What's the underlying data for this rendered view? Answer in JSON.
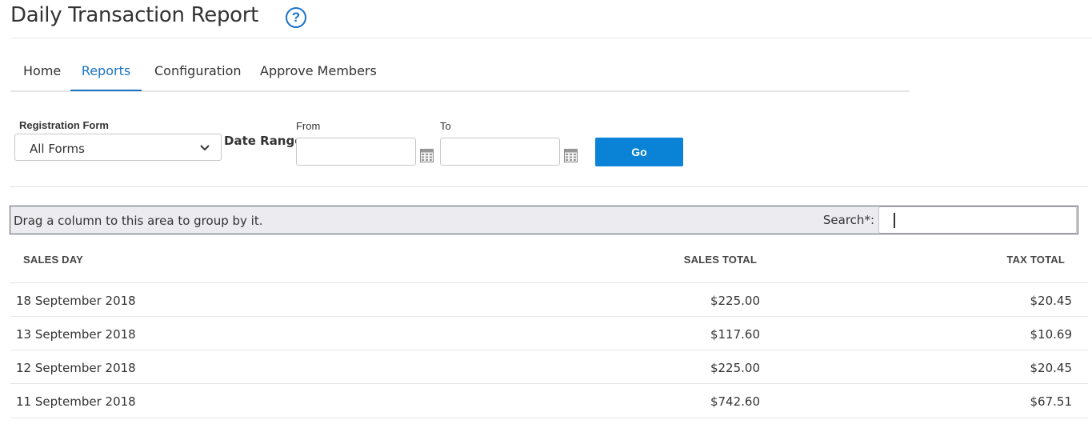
{
  "page": {
    "title": "Daily Transaction Report",
    "help": "?"
  },
  "tabs": [
    {
      "label": "Home",
      "active": false
    },
    {
      "label": "Reports",
      "active": true
    },
    {
      "label": "Configuration",
      "active": false
    },
    {
      "label": "Approve Members",
      "active": false
    }
  ],
  "filters": {
    "registration_label": "Registration Form",
    "registration_value": "All Forms",
    "date_range_label": "Date Range:",
    "from_label": "From",
    "to_label": "To",
    "from_value": "",
    "to_value": "",
    "go_label": "Go"
  },
  "grid": {
    "group_hint": "Drag a column to this area to group by it.",
    "search_label": "Search*:",
    "search_value": "",
    "columns": [
      "SALES DAY",
      "SALES TOTAL",
      "TAX TOTAL"
    ],
    "rows": [
      {
        "day": "18 September 2018",
        "sales": "$225.00",
        "tax": "$20.45"
      },
      {
        "day": "13 September 2018",
        "sales": "$117.60",
        "tax": "$10.69"
      },
      {
        "day": "12 September 2018",
        "sales": "$225.00",
        "tax": "$20.45"
      },
      {
        "day": "11 September 2018",
        "sales": "$742.60",
        "tax": "$67.51"
      }
    ]
  },
  "colors": {
    "accent": "#1a73c8",
    "button": "#0a82d6"
  }
}
